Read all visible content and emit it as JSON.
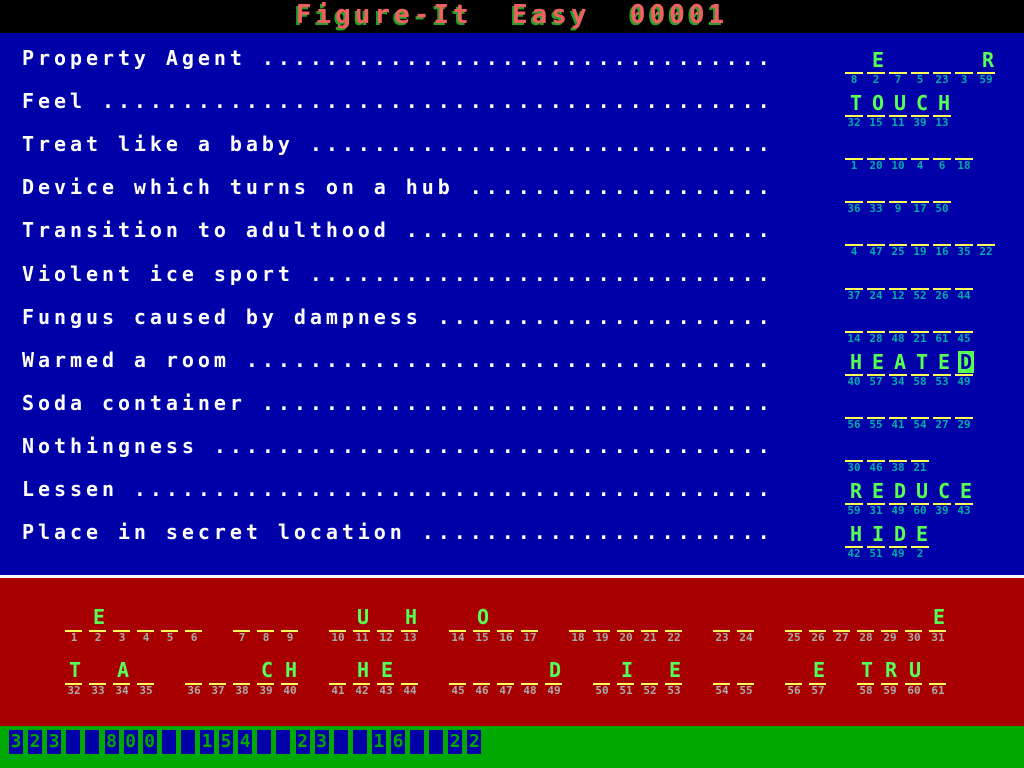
{
  "header": {
    "title": "Figure-It  Easy  00001"
  },
  "colors": {
    "clue_background": "#0000a8",
    "puzzle_background": "#a80000",
    "status_background": "#00a800",
    "letter_color": "#55ff55",
    "underline_color": "#ffff55",
    "clue_number_color": "#00aaaa",
    "puzzle_number_color": "#aaaaaa",
    "title_color": "#f06060"
  },
  "clues": [
    {
      "label": "Property Agent",
      "letters": [
        "",
        "E",
        "",
        "",
        "",
        "",
        "R"
      ],
      "numbers": [
        8,
        2,
        7,
        5,
        23,
        3,
        59
      ]
    },
    {
      "label": "Feel",
      "letters": [
        "T",
        "O",
        "U",
        "C",
        "H"
      ],
      "numbers": [
        32,
        15,
        11,
        39,
        13
      ]
    },
    {
      "label": "Treat like a baby",
      "letters": [
        "",
        "",
        "",
        "",
        "",
        ""
      ],
      "numbers": [
        1,
        20,
        10,
        4,
        6,
        18
      ]
    },
    {
      "label": "Device which turns on a hub",
      "letters": [
        "",
        "",
        "",
        "",
        ""
      ],
      "numbers": [
        36,
        33,
        9,
        17,
        50
      ]
    },
    {
      "label": "Transition to adulthood",
      "letters": [
        "",
        "",
        "",
        "",
        "",
        "",
        ""
      ],
      "numbers": [
        4,
        47,
        25,
        19,
        16,
        35,
        22
      ]
    },
    {
      "label": "Violent ice sport",
      "letters": [
        "",
        "",
        "",
        "",
        "",
        ""
      ],
      "numbers": [
        37,
        24,
        12,
        52,
        26,
        44
      ]
    },
    {
      "label": "Fungus caused by dampness",
      "letters": [
        "",
        "",
        "",
        "",
        "",
        ""
      ],
      "numbers": [
        14,
        28,
        48,
        21,
        61,
        45
      ]
    },
    {
      "label": "Warmed a room",
      "letters": [
        "H",
        "E",
        "A",
        "T",
        "E",
        "D"
      ],
      "numbers": [
        40,
        57,
        34,
        58,
        53,
        49
      ],
      "cursor_index": 5
    },
    {
      "label": "Soda container",
      "letters": [
        "",
        "",
        "",
        "",
        "",
        ""
      ],
      "numbers": [
        56,
        55,
        41,
        54,
        27,
        29
      ]
    },
    {
      "label": "Nothingness",
      "letters": [
        "",
        "",
        "",
        ""
      ],
      "numbers": [
        30,
        46,
        38,
        21
      ]
    },
    {
      "label": "Lessen",
      "letters": [
        "R",
        "E",
        "D",
        "U",
        "C",
        "E"
      ],
      "numbers": [
        59,
        31,
        49,
        60,
        39,
        43
      ]
    },
    {
      "label": "Place in secret location",
      "letters": [
        "H",
        "I",
        "D",
        "E"
      ],
      "numbers": [
        42,
        51,
        49,
        2
      ]
    }
  ],
  "puzzle": {
    "rows": [
      [
        [
          {
            "n": 1,
            "c": ""
          },
          {
            "n": 2,
            "c": "E"
          },
          {
            "n": 3,
            "c": ""
          },
          {
            "n": 4,
            "c": ""
          },
          {
            "n": 5,
            "c": ""
          },
          {
            "n": 6,
            "c": ""
          }
        ],
        [
          {
            "n": 7,
            "c": ""
          },
          {
            "n": 8,
            "c": ""
          },
          {
            "n": 9,
            "c": ""
          }
        ],
        [
          {
            "n": 10,
            "c": ""
          },
          {
            "n": 11,
            "c": "U"
          },
          {
            "n": 12,
            "c": ""
          },
          {
            "n": 13,
            "c": "H"
          }
        ],
        [
          {
            "n": 14,
            "c": ""
          },
          {
            "n": 15,
            "c": "O"
          },
          {
            "n": 16,
            "c": ""
          },
          {
            "n": 17,
            "c": ""
          }
        ],
        [
          {
            "n": 18,
            "c": ""
          },
          {
            "n": 19,
            "c": ""
          },
          {
            "n": 20,
            "c": ""
          },
          {
            "n": 21,
            "c": ""
          },
          {
            "n": 22,
            "c": ""
          }
        ],
        [
          {
            "n": 23,
            "c": ""
          },
          {
            "n": 24,
            "c": ""
          }
        ],
        [
          {
            "n": 25,
            "c": ""
          },
          {
            "n": 26,
            "c": ""
          },
          {
            "n": 27,
            "c": ""
          },
          {
            "n": 28,
            "c": ""
          },
          {
            "n": 29,
            "c": ""
          },
          {
            "n": 30,
            "c": ""
          },
          {
            "n": 31,
            "c": "E"
          }
        ]
      ],
      [
        [
          {
            "n": 32,
            "c": "T"
          },
          {
            "n": 33,
            "c": ""
          },
          {
            "n": 34,
            "c": "A"
          },
          {
            "n": 35,
            "c": ""
          }
        ],
        [
          {
            "n": 36,
            "c": ""
          },
          {
            "n": 37,
            "c": ""
          },
          {
            "n": 38,
            "c": ""
          },
          {
            "n": 39,
            "c": "C"
          },
          {
            "n": 40,
            "c": "H"
          }
        ],
        [
          {
            "n": 41,
            "c": ""
          },
          {
            "n": 42,
            "c": "H"
          },
          {
            "n": 43,
            "c": "E"
          },
          {
            "n": 44,
            "c": ""
          }
        ],
        [
          {
            "n": 45,
            "c": ""
          },
          {
            "n": 46,
            "c": ""
          },
          {
            "n": 47,
            "c": ""
          },
          {
            "n": 48,
            "c": ""
          },
          {
            "n": 49,
            "c": "D"
          }
        ],
        [
          {
            "n": 50,
            "c": ""
          },
          {
            "n": 51,
            "c": "I"
          },
          {
            "n": 52,
            "c": ""
          },
          {
            "n": 53,
            "c": "E"
          }
        ],
        [
          {
            "n": 54,
            "c": ""
          },
          {
            "n": 55,
            "c": ""
          }
        ],
        [
          {
            "n": 56,
            "c": ""
          },
          {
            "n": 57,
            "c": "E"
          }
        ],
        [
          {
            "n": 58,
            "c": "T"
          },
          {
            "n": 59,
            "c": "R"
          },
          {
            "n": 60,
            "c": "U"
          },
          {
            "n": 61,
            "c": ""
          }
        ]
      ]
    ]
  },
  "status": {
    "cells": [
      "3",
      "2",
      "3",
      " ",
      " ",
      "8",
      "0",
      "0",
      " ",
      " ",
      "1",
      "5",
      "4",
      " ",
      " ",
      "2",
      "3",
      " ",
      " ",
      "1",
      "6",
      " ",
      " ",
      "2",
      "2"
    ]
  }
}
